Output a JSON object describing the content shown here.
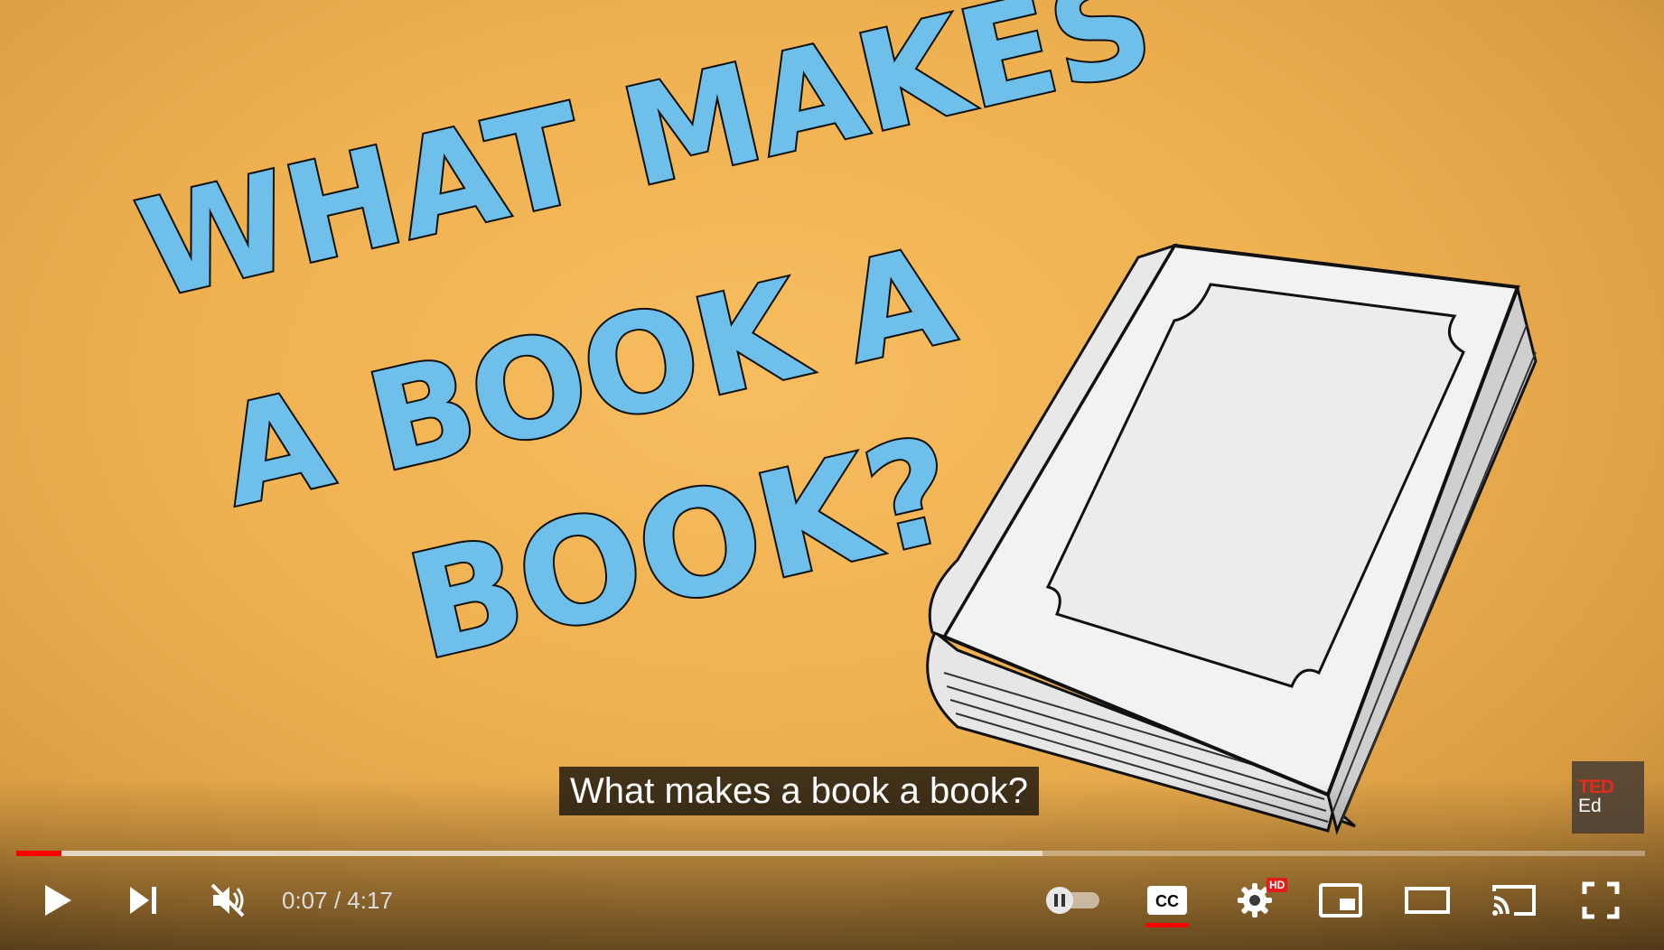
{
  "video": {
    "title_art_lines": [
      "WHAT MAKES",
      "A BOOK A",
      "BOOK?"
    ],
    "caption": "What makes a book a book?",
    "watermark": {
      "line1": "TED",
      "line2": "Ed"
    }
  },
  "progress": {
    "played_fraction": 0.028,
    "buffered_fraction": 0.63,
    "played_color": "#ff0000"
  },
  "controls": {
    "current_time": "0:07",
    "separator": " / ",
    "duration": "4:17",
    "settings_badge": "HD",
    "icons": [
      "play-icon",
      "next-icon",
      "volume-muted-icon",
      "autoplay-toggle-icon",
      "captions-icon",
      "settings-icon",
      "miniplayer-icon",
      "theater-mode-icon",
      "cast-icon",
      "fullscreen-icon"
    ]
  }
}
